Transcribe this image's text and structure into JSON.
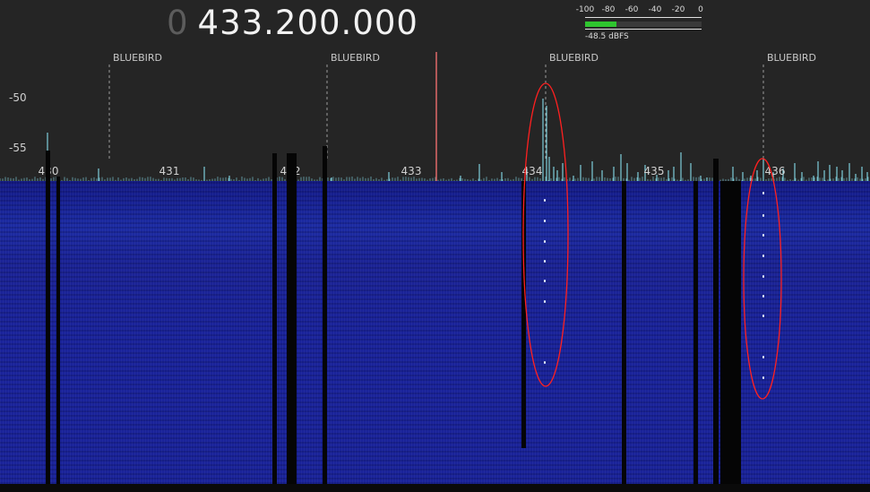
{
  "frequency": {
    "prefix": "0",
    "value": "433.200.000"
  },
  "signal_meter": {
    "scale_labels": [
      "-100",
      "-80",
      "-60",
      "-40",
      "-20",
      "0"
    ],
    "level_dbfs": -48.5,
    "readout": "-48.5 dBFS",
    "bar_color": "#2fc52f"
  },
  "spectrum": {
    "y_axis_labels": [
      "-50",
      "-55"
    ],
    "freq_axis_labels": [
      "430",
      "431",
      "432",
      "433",
      "434",
      "435",
      "436"
    ],
    "bookmarks": [
      "BLUEBIRD",
      "BLUEBIRD",
      "BLUEBIRD",
      "BLUEBIRD"
    ],
    "tuned_marker_color": "#e06a6a",
    "trace_color": "#8ff0ff"
  },
  "waterfall": {
    "colors": {
      "background": "#1a2399",
      "annotation_ellipse": "#ff2020"
    }
  }
}
